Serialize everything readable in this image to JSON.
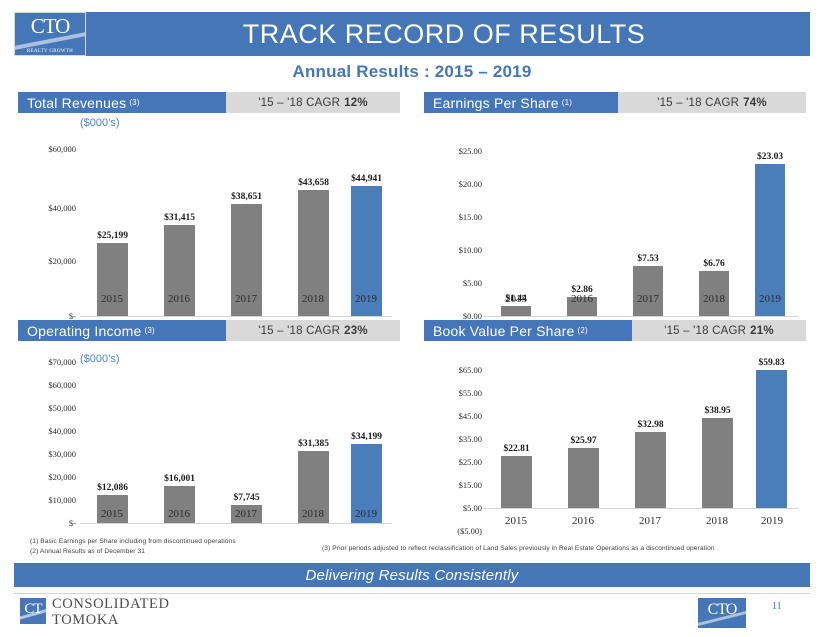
{
  "header": {
    "title": "TRACK RECORD OF RESULTS",
    "logo_mark": "CTO",
    "logo_tagline": "REALTY GROWTH"
  },
  "subtitle": "Annual Results : 2015 – 2019",
  "panels": {
    "revenues": {
      "title": "Total Revenues",
      "title_sup": "(3)",
      "cagr_label": "'15 – '18 CAGR",
      "cagr_value": "12%",
      "units": "($000’s)"
    },
    "eps": {
      "title": "Earnings Per Share",
      "title_sup": "(1)",
      "cagr_label": "'15 – '18 CAGR",
      "cagr_value": "74%",
      "units": ""
    },
    "operating_income": {
      "title": "Operating Income",
      "title_sup": "(3)",
      "cagr_label": "'15 – '18 CAGR",
      "cagr_value": "23%",
      "units": "($000’s)"
    },
    "book_value": {
      "title": "Book Value Per Share",
      "title_sup": "(2)",
      "cagr_label": "'15 – '18 CAGR",
      "cagr_value": "21%",
      "units": ""
    }
  },
  "footnotes": {
    "left": "(1) Basic Earnings per Share including from discontinued operations\n(2) Annual Results as of December 31",
    "right": "(3) Prior periods adjusted to reflect reclassification of Land Sales previously in Real Estate Operations as a discontinued operation"
  },
  "tagline": "Delivering Results Consistently",
  "footer": {
    "company_line1": "CONSOLIDATED",
    "company_line2": "TOMOKA",
    "logo_mark": "CTO",
    "ct_mark": "CT",
    "page_number": "11"
  },
  "colors": {
    "brand_blue": "#4476B8",
    "bar_blue": "#4A7EBB",
    "bar_gray": "#808080",
    "band_gray": "#d9d9d9",
    "units_blue": "#4A86C8"
  },
  "chart_data": [
    {
      "id": "total-revenues",
      "type": "bar",
      "title": "Total Revenues",
      "subtitle": "'15 – '18 CAGR 12%",
      "ylabel": "($000's)",
      "xlabel": "",
      "categories": [
        "2015",
        "2016",
        "2017",
        "2018",
        "2019"
      ],
      "values": [
        25199,
        31415,
        38651,
        43658,
        44941
      ],
      "data_labels": [
        "$25,199",
        "$31,415",
        "$38,651",
        "$43,658",
        "$44,941"
      ],
      "ylim": [
        0,
        60000
      ],
      "yticks": [
        0,
        20000,
        40000,
        60000
      ],
      "ytick_labels": [
        "$-",
        "$20,000",
        "$40,000",
        "$60,000"
      ],
      "grid": false,
      "legend": "none",
      "highlight_index": 4,
      "colors": [
        "#808080",
        "#808080",
        "#808080",
        "#808080",
        "#4A7EBB"
      ]
    },
    {
      "id": "earnings-per-share",
      "type": "bar",
      "title": "Earnings Per Share",
      "subtitle": "'15 – '18 CAGR 74%",
      "ylabel": "",
      "xlabel": "",
      "categories": [
        "2015",
        "2016",
        "2017",
        "2018",
        "2019"
      ],
      "values": [
        1.44,
        2.86,
        7.53,
        6.76,
        23.03
      ],
      "data_labels": [
        "$1.44",
        "$2.86",
        "$7.53",
        "$6.76",
        "$23.03"
      ],
      "ylim": [
        0,
        25
      ],
      "yticks": [
        0,
        5,
        10,
        15,
        20,
        25
      ],
      "ytick_labels": [
        "$0.00",
        "$5.00",
        "$10.00",
        "$15.00",
        "$20.00",
        "$25.00"
      ],
      "grid": false,
      "legend": "none",
      "highlight_index": 4,
      "colors": [
        "#808080",
        "#808080",
        "#808080",
        "#808080",
        "#4A7EBB"
      ]
    },
    {
      "id": "operating-income",
      "type": "bar",
      "title": "Operating Income",
      "subtitle": "'15 – '18 CAGR 23%",
      "ylabel": "($000's)",
      "xlabel": "",
      "categories": [
        "2015",
        "2016",
        "2017",
        "2018",
        "2019"
      ],
      "values": [
        12086,
        16001,
        7745,
        31385,
        34199
      ],
      "data_labels": [
        "$12,086",
        "$16,001",
        "$7,745",
        "$31,385",
        "$34,199"
      ],
      "ylim": [
        0,
        70000
      ],
      "yticks": [
        0,
        10000,
        20000,
        30000,
        40000,
        50000,
        60000,
        70000
      ],
      "ytick_labels": [
        "$-",
        "$10,000",
        "$20,000",
        "$30,000",
        "$40,000",
        "$50,000",
        "$60,000",
        "$70,000"
      ],
      "grid": false,
      "legend": "none",
      "highlight_index": 4,
      "colors": [
        "#808080",
        "#808080",
        "#808080",
        "#808080",
        "#4A7EBB"
      ]
    },
    {
      "id": "book-value-per-share",
      "type": "bar",
      "title": "Book Value Per Share",
      "subtitle": "'15 – '18 CAGR 21%",
      "ylabel": "",
      "xlabel": "",
      "categories": [
        "2015",
        "2016",
        "2017",
        "2018",
        "2019"
      ],
      "values": [
        22.81,
        25.97,
        32.98,
        38.95,
        59.83
      ],
      "data_labels": [
        "$22.81",
        "$25.97",
        "$32.98",
        "$38.95",
        "$59.83"
      ],
      "ylim": [
        -5,
        65
      ],
      "yticks": [
        -5,
        5,
        15,
        25,
        35,
        45,
        55,
        65
      ],
      "ytick_labels": [
        "($5.00)",
        "$5.00",
        "$15.00",
        "$25.00",
        "$35.00",
        "$45.00",
        "$55.00",
        "$65.00"
      ],
      "grid": false,
      "legend": "none",
      "highlight_index": 4,
      "colors": [
        "#808080",
        "#808080",
        "#808080",
        "#808080",
        "#4A7EBB"
      ]
    }
  ]
}
